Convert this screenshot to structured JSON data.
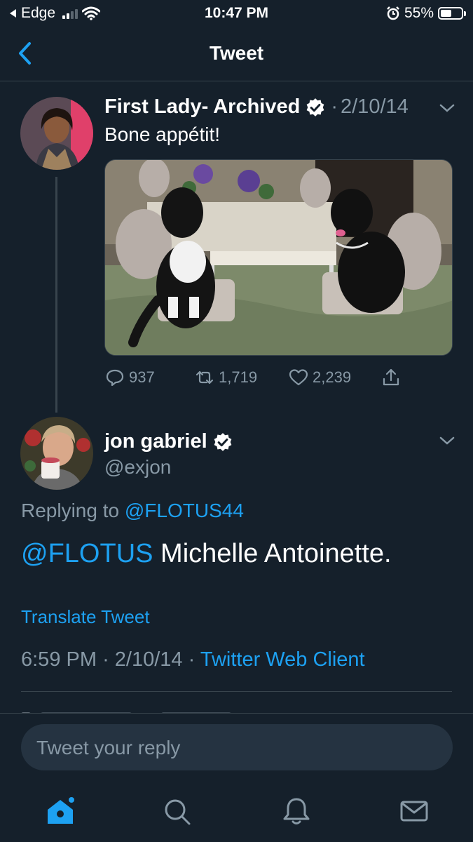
{
  "status_bar": {
    "carrier": "Edge",
    "time": "10:47 PM",
    "battery_percent": "55%",
    "battery_level": 0.55,
    "signal_bars": 2
  },
  "nav": {
    "title": "Tweet",
    "back_icon": "chevron-left-icon"
  },
  "parent_tweet": {
    "author_name": "First Lady- Archived",
    "verified": true,
    "date_separator": "·",
    "date": "2/10/14",
    "text": "Bone appétit!",
    "image_alt": "two-dogs-at-dining-table-photo",
    "replies": "937",
    "retweets": "1,719",
    "likes": "2,239"
  },
  "main_tweet": {
    "author_name": "jon gabriel",
    "verified": true,
    "handle": "@exjon",
    "replying_prefix": "Replying to",
    "replying_to": "@FLOTUS44",
    "mention": "@FLOTUS",
    "text": " Michelle Antoinette.",
    "translate_label": "Translate Tweet",
    "time": "6:59 PM",
    "sep1": "·",
    "date": "2/10/14",
    "sep2": "·",
    "client": "Twitter Web Client"
  },
  "composer": {
    "placeholder": "Tweet your reply"
  },
  "tabbar": {
    "items": [
      "home-icon",
      "search-icon",
      "notifications-icon",
      "messages-icon"
    ],
    "active": "home-icon"
  },
  "colors": {
    "background": "#15202b",
    "accent": "#1da1f2",
    "secondary_text": "#8899a6",
    "divider": "#38444d",
    "composer_bg": "#253341"
  }
}
